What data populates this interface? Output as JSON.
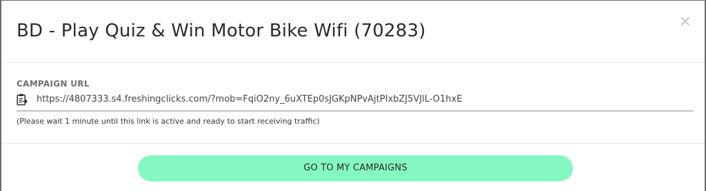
{
  "modal": {
    "title": "BD - Play Quiz & Win Motor Bike Wifi (70283)",
    "close_label": "✕"
  },
  "campaign": {
    "section_label": "CAMPAIGN URL",
    "url": "https://4807333.s4.freshingclicks.com/?mob=FqiO2ny_6uXTEp0sJGKpNPvAjtPIxbZJ5VJlL-O1hxE",
    "note": "(Please wait 1 minute until this link is active and ready to start receiving traffic)"
  },
  "footer": {
    "primary_button_label": "GO TO MY CAMPAIGNS"
  },
  "colors": {
    "button_bg": "#85f8c1",
    "text": "#2b2b2b",
    "muted": "#6f6f6f"
  },
  "icons": {
    "copy": "clipboard-icon",
    "close": "close-icon"
  }
}
